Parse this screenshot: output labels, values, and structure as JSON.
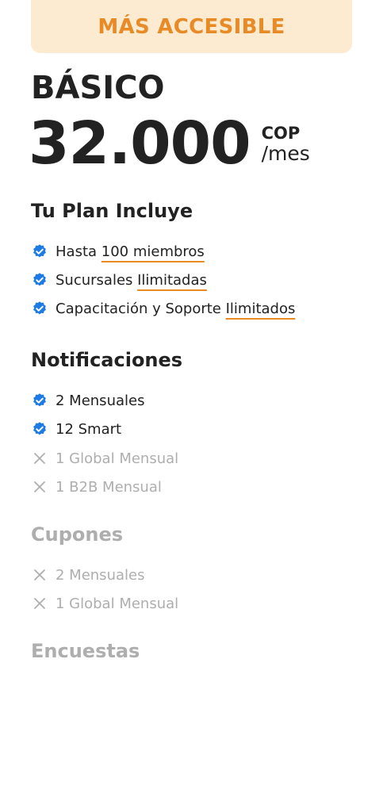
{
  "badge": {
    "label": "MÁS ACCESIBLE"
  },
  "plan": {
    "name": "BÁSICO",
    "price": "32.000",
    "currency": "COP",
    "period": "/mes"
  },
  "colors": {
    "accent": "#E88A26",
    "badge_bg": "#FCEBD0",
    "check": "#1E7BE6",
    "muted": "#AEAEAE",
    "text": "#222222"
  },
  "sections": {
    "plan": {
      "title": "Tu Plan Incluye",
      "items": [
        {
          "prefix": "Hasta ",
          "highlight": "100 miembros",
          "icon": "verified-check-icon"
        },
        {
          "prefix": "Sucursales ",
          "highlight": "Ilimitadas",
          "icon": "verified-check-icon"
        },
        {
          "prefix": "Capacitación y Soporte ",
          "highlight": "Ilimitados",
          "icon": "verified-check-icon"
        }
      ]
    },
    "notifications": {
      "title": "Notificaciones",
      "items": [
        {
          "label": "2 Mensuales",
          "included": true,
          "icon": "verified-check-icon"
        },
        {
          "label": "12 Smart",
          "included": true,
          "icon": "verified-check-icon"
        },
        {
          "label": "1 Global Mensual",
          "included": false,
          "icon": "x-icon"
        },
        {
          "label": "1 B2B Mensual",
          "included": false,
          "icon": "x-icon"
        }
      ]
    },
    "coupons": {
      "title": "Cupones",
      "items": [
        {
          "label": "2 Mensuales",
          "included": false,
          "icon": "x-icon"
        },
        {
          "label": "1 Global Mensual",
          "included": false,
          "icon": "x-icon"
        }
      ]
    },
    "surveys": {
      "title": "Encuestas"
    }
  }
}
